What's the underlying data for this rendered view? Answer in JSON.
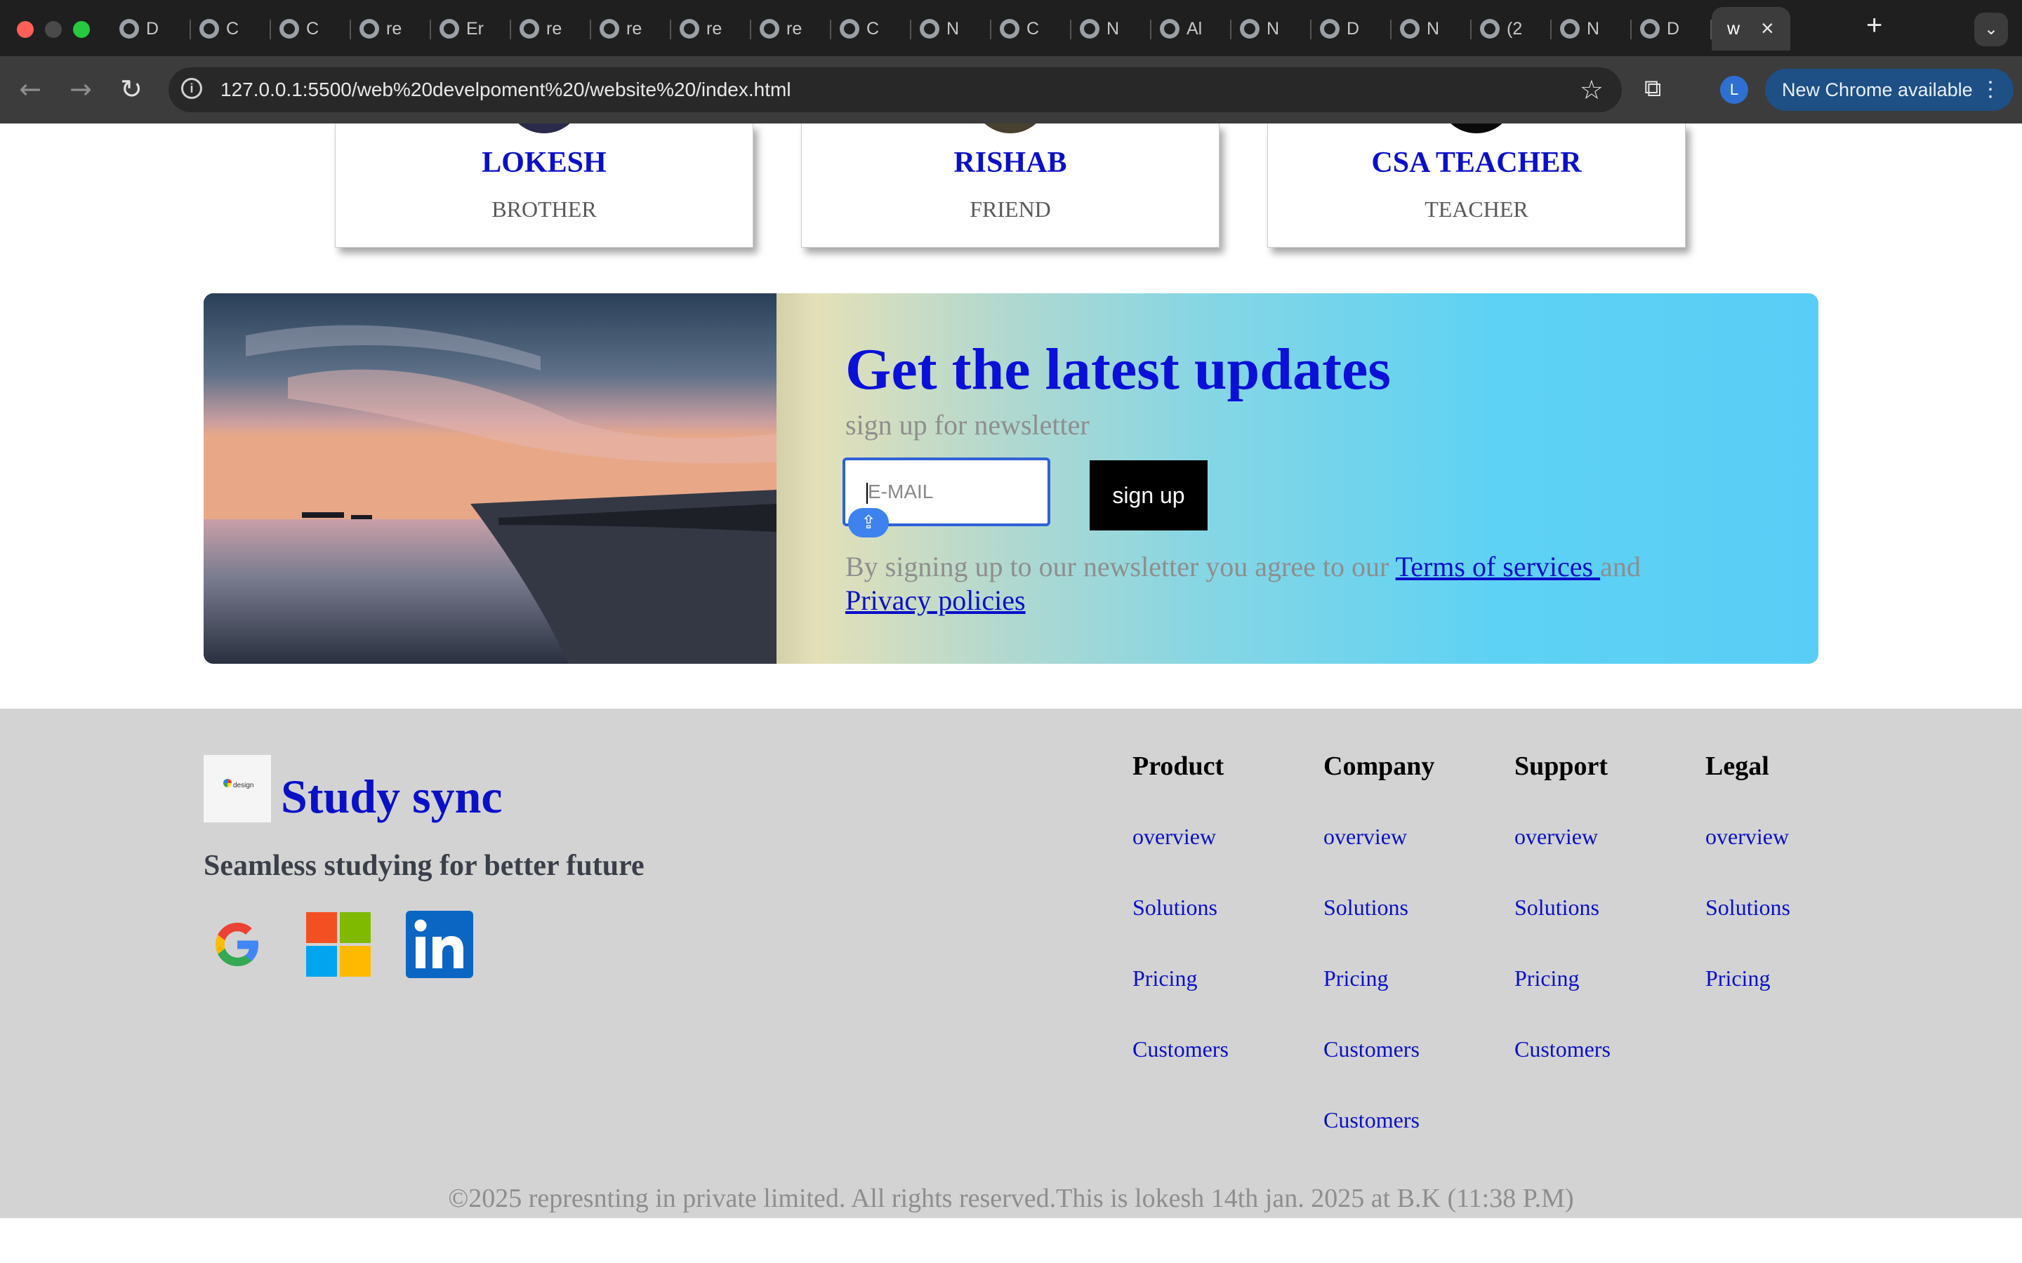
{
  "browser": {
    "tabs": [
      {
        "label": "D",
        "icon": "target-icon"
      },
      {
        "label": "C",
        "icon": "globe-icon"
      },
      {
        "label": "C",
        "icon": "globe-icon"
      },
      {
        "label": "re",
        "icon": "globe-icon"
      },
      {
        "label": "Er",
        "icon": "globe-icon"
      },
      {
        "label": "re",
        "icon": "globe-icon"
      },
      {
        "label": "re",
        "icon": "globe-icon"
      },
      {
        "label": "re",
        "icon": "globe-icon"
      },
      {
        "label": "re",
        "icon": "globe-icon"
      },
      {
        "label": "C",
        "icon": "globe-icon"
      },
      {
        "label": "N",
        "icon": "chrome-icon"
      },
      {
        "label": "C",
        "icon": "globe-icon"
      },
      {
        "label": "N",
        "icon": "chrome-icon"
      },
      {
        "label": "Al",
        "icon": "globe-icon"
      },
      {
        "label": "N",
        "icon": "chrome-icon"
      },
      {
        "label": "D",
        "icon": "avatar-icon"
      },
      {
        "label": "N",
        "icon": "chrome-icon"
      },
      {
        "label": "(2",
        "icon": "linkedin-icon"
      },
      {
        "label": "N",
        "icon": "globe-icon"
      },
      {
        "label": "D",
        "icon": "globe-icon"
      },
      {
        "label": "w",
        "icon": "globe-icon"
      }
    ],
    "active_tab": {
      "label": "w"
    },
    "url": "127.0.0.1:5500/web%20develpoment%20/website%20/index.html",
    "profile_initial": "L",
    "update_label": "New Chrome available"
  },
  "cards": [
    {
      "name": "LOKESH",
      "relation": "BROTHER",
      "ring_color": "#2a2a4a"
    },
    {
      "name": "RISHAB",
      "relation": "FRIEND",
      "ring_color": "#4a4030"
    },
    {
      "name": "CSA TEACHER",
      "relation": "TEACHER",
      "ring_color": "#0a0a0a"
    }
  ],
  "newsletter": {
    "title": "Get the latest updates",
    "subtitle": "sign up for newsletter",
    "email_placeholder": "E-MAIL",
    "button": "sign up",
    "terms_prefix": "By signing up to our newsletter you agree to our ",
    "terms_link": "Terms of services ",
    "terms_and": "and",
    "privacy_link": "Privacy policies"
  },
  "footer": {
    "logo_text": "design",
    "brand": "Study sync",
    "tagline": "Seamless studying for better future",
    "socials": [
      "google-icon",
      "microsoft-icon",
      "linkedin-icon"
    ],
    "columns": [
      {
        "title": "Product",
        "links": [
          "overview",
          "Solutions",
          "Pricing",
          "Customers"
        ]
      },
      {
        "title": "Company",
        "links": [
          "overview",
          "Solutions",
          "Pricing",
          "Customers",
          "Customers"
        ]
      },
      {
        "title": "Support",
        "links": [
          "overview",
          "Solutions",
          "Pricing",
          "Customers"
        ]
      },
      {
        "title": "Legal",
        "links": [
          "overview",
          "Solutions",
          "Pricing"
        ]
      }
    ],
    "copyright": "©2025 represnting in private limited. All rights reserved.This is lokesh 14th jan. 2025 at B.K (11:38 P.M)"
  },
  "colors": {
    "link_blue": "#0a10c8",
    "footer_bg": "#d3d3d3",
    "tab_bg": "#1f1f1f"
  }
}
